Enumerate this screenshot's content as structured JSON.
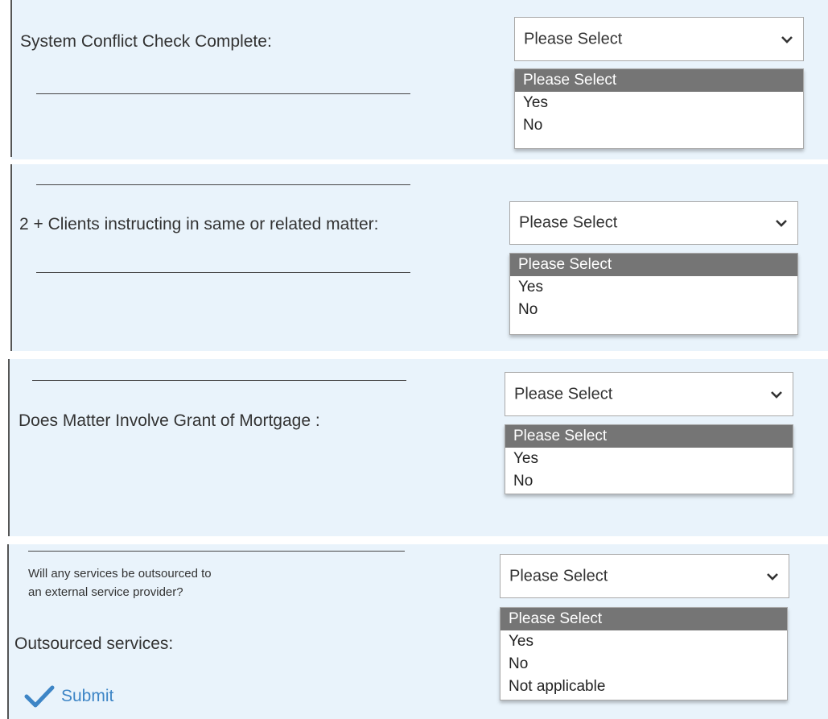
{
  "form": {
    "sections": [
      {
        "label": "System Conflict Check Complete:",
        "select": {
          "value": "Please Select",
          "options": [
            "Please Select",
            "Yes",
            "No"
          ]
        }
      },
      {
        "label": "2 + Clients instructing in same or related matter:",
        "select": {
          "value": "Please Select",
          "options": [
            "Please Select",
            "Yes",
            "No"
          ]
        }
      },
      {
        "label": "Does Matter Involve Grant of Mortgage :",
        "select": {
          "value": "Please Select",
          "options": [
            "Please Select",
            "Yes",
            "No"
          ]
        }
      },
      {
        "question_line1": "Will any services be outsourced to",
        "question_line2": "an external service provider?",
        "label": "Outsourced services:",
        "select": {
          "value": "Please Select",
          "options": [
            "Please Select",
            "Yes",
            "No",
            "Not applicable"
          ]
        }
      }
    ],
    "submit_label": "Submit"
  },
  "colors": {
    "panel_bg": "#e9f3fb",
    "option_selected_bg": "#757575",
    "submit_blue": "#3d85c6"
  },
  "icons": {
    "dropdown": "chevron-down-icon",
    "submit": "checkmark-icon"
  }
}
